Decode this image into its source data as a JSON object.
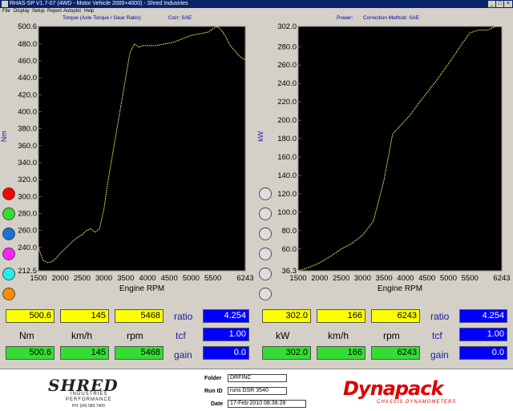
{
  "window": {
    "title": "RHAS-SP V1.7-07  (4WD - Motor Vehicle 2000+4000) - Shred Industries"
  },
  "menu": {
    "items": [
      "File",
      "Display",
      "Setup",
      "Report",
      "Autoplot",
      "Help"
    ]
  },
  "torque_panel": {
    "title": "Torque (Axle Torque / Gear Ratio):",
    "corr": "Corr: SAE",
    "unit": "Nm",
    "xlabel": "Engine RPM",
    "y_ticks": [
      "500.6",
      "480.0",
      "460.0",
      "440.0",
      "420.0",
      "400.0",
      "380.0",
      "360.0",
      "340.0",
      "320.0",
      "300.0",
      "280.0",
      "260.0",
      "240.0",
      "212.5"
    ],
    "x_ticks": [
      "1500",
      "2000",
      "2500",
      "3000",
      "3500",
      "4000",
      "4500",
      "5000",
      "5500",
      "6243"
    ],
    "circle_colors": [
      "#ff0000",
      "#33dd33",
      "#1e6ed8",
      "#ff22ff",
      "#22eeee",
      "#ff8c00"
    ]
  },
  "power_panel": {
    "title": "Power:",
    "corr": "Correction Method: SAE",
    "unit": "kW",
    "xlabel": "Engine RPM",
    "y_ticks": [
      "302.0",
      "280.0",
      "260.0",
      "240.0",
      "220.0",
      "200.0",
      "180.0",
      "160.0",
      "140.0",
      "120.0",
      "100.0",
      "80.0",
      "60.0",
      "36.3"
    ],
    "x_ticks": [
      "1500",
      "2000",
      "2500",
      "3000",
      "3500",
      "4000",
      "4500",
      "5000",
      "5500",
      "6243"
    ],
    "circle_colors": [
      "#dddddd",
      "#dddddd",
      "#dddddd",
      "#dddddd",
      "#dddddd",
      "#dddddd"
    ]
  },
  "readout_left": {
    "yellow": [
      "500.6",
      "145",
      "5468"
    ],
    "units": [
      "Nm",
      "km/h",
      "rpm"
    ],
    "green": [
      "500.6",
      "145",
      "5468"
    ],
    "ratio_label": "ratio",
    "ratio": "4.254",
    "tcf_label": "tcf",
    "tcf": "1.00",
    "gain_label": "gain",
    "gain": "0.0"
  },
  "readout_right": {
    "yellow": [
      "302.0",
      "166",
      "6243"
    ],
    "units": [
      "kW",
      "km/h",
      "rpm"
    ],
    "green": [
      "302.0",
      "166",
      "6243"
    ],
    "ratio_label": "ratio",
    "ratio": "4.254",
    "tcf_label": "tcf",
    "tcf": "1.00",
    "gain_label": "gain",
    "gain": "0.0"
  },
  "footer": {
    "folder_label": "Folder",
    "folder": "DRFINC",
    "runid_label": "Run ID",
    "runid": "runs DSR 3540",
    "date_label": "Date",
    "date": "17-Feb-2010  08:38:28",
    "logo_left_main": "SHRED",
    "logo_left_sub": "INDUSTRIES",
    "logo_left_sub2": "PERFORMANCE",
    "logo_left_phone": "PH: (04) 580 7409",
    "logo_right_main": "Dynapack",
    "logo_right_sub": "CHASSIS DYNAMOMETERS"
  },
  "chart_data": [
    {
      "type": "line",
      "ylabel": "Nm",
      "xlabel": "Engine RPM",
      "xlim": [
        1500,
        6243
      ],
      "ylim": [
        212.5,
        500.6
      ],
      "series": [
        {
          "color": "#ffff66",
          "x": [
            1500,
            1600,
            1700,
            1800,
            1900,
            2000,
            2100,
            2200,
            2300,
            2400,
            2500,
            2600,
            2700,
            2800,
            2900,
            3000,
            3100,
            3200,
            3300,
            3400,
            3500,
            3600,
            3700,
            3800,
            3900,
            4000,
            4200,
            4400,
            4600,
            4800,
            5000,
            5200,
            5400,
            5500,
            5600,
            5700,
            5800,
            5900,
            6000,
            6100,
            6243
          ],
          "y": [
            240,
            225,
            222,
            223,
            227,
            233,
            238,
            243,
            248,
            252,
            255,
            260,
            262,
            258,
            262,
            285,
            320,
            350,
            380,
            410,
            440,
            470,
            480,
            476,
            478,
            478,
            478,
            480,
            482,
            486,
            490,
            492,
            494,
            498,
            500.6,
            496,
            488,
            478,
            472,
            466,
            461
          ]
        }
      ]
    },
    {
      "type": "line",
      "ylabel": "kW",
      "xlabel": "Engine RPM",
      "xlim": [
        1500,
        6243
      ],
      "ylim": [
        36.3,
        302.0
      ],
      "series": [
        {
          "color": "#ffff66",
          "x": [
            1500,
            1750,
            2000,
            2250,
            2500,
            2750,
            3000,
            3250,
            3500,
            3700,
            3900,
            4100,
            4300,
            4500,
            4700,
            4900,
            5100,
            5300,
            5500,
            5700,
            5900,
            6000,
            6100,
            6243
          ],
          "y": [
            36.3,
            40,
            45,
            52,
            60,
            66,
            75,
            90,
            135,
            185,
            195,
            205,
            218,
            230,
            242,
            255,
            268,
            282,
            295,
            298,
            298,
            300,
            302,
            302
          ]
        }
      ]
    }
  ]
}
